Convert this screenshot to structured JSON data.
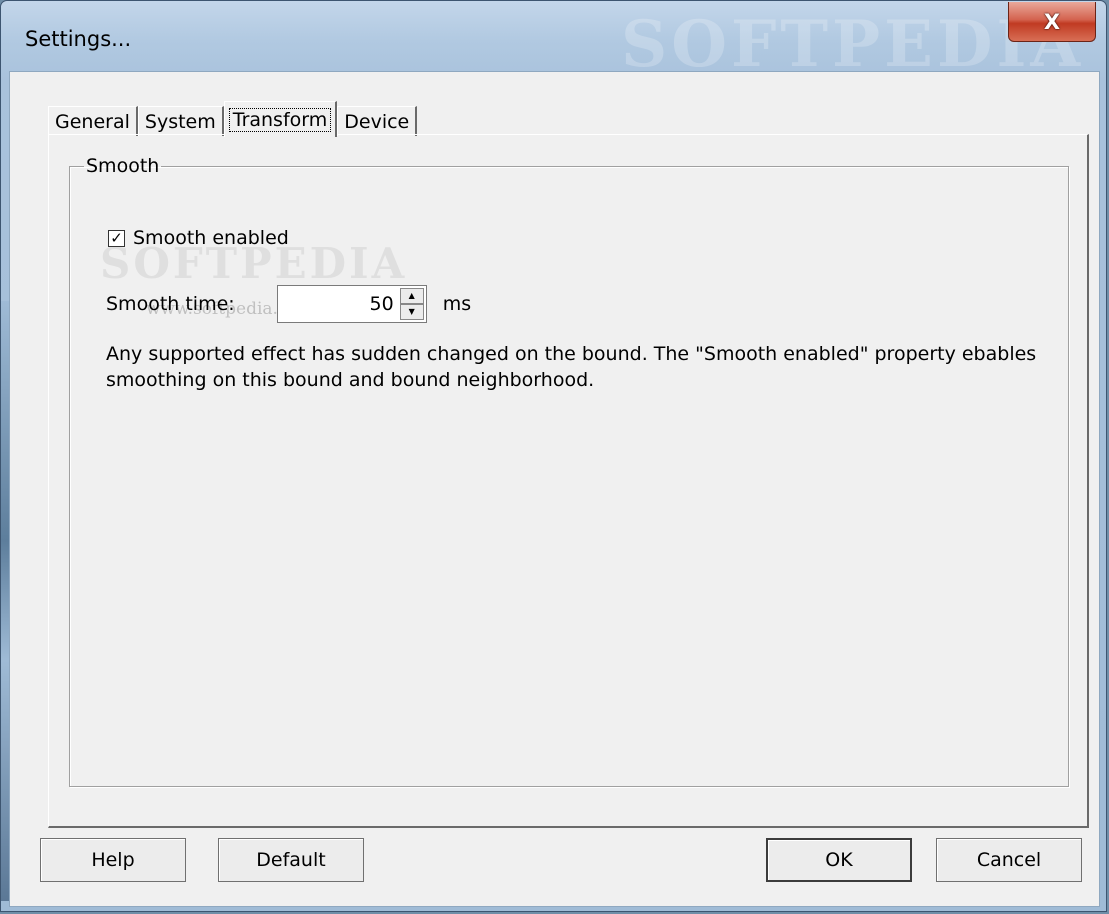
{
  "window": {
    "title": "Settings...",
    "close_glyph": "X",
    "watermark": "SOFTPEDIA"
  },
  "tabs": [
    {
      "label": "General",
      "active": false
    },
    {
      "label": "System",
      "active": false
    },
    {
      "label": "Transform",
      "active": true
    },
    {
      "label": "Device",
      "active": false
    }
  ],
  "smooth_group": {
    "legend": "Smooth",
    "enabled_label": "Smooth enabled",
    "enabled_checked": true,
    "check_glyph": "✓",
    "time_label": "Smooth time:",
    "time_value": "50",
    "time_unit": "ms",
    "description": "Any supported effect has sudden changed on the bound. The \"Smooth enabled\" property ebables smoothing on this bound and bound neighborhood.",
    "watermark": "SOFTPEDIA",
    "watermark_url": "www.softpedia.com"
  },
  "buttons": {
    "help": "Help",
    "default": "Default",
    "ok": "OK",
    "cancel": "Cancel"
  },
  "icons": {
    "close": "close-icon",
    "spin_up": "spin-up-arrow-icon",
    "spin_down": "spin-down-arrow-icon",
    "check": "checkmark-icon"
  }
}
